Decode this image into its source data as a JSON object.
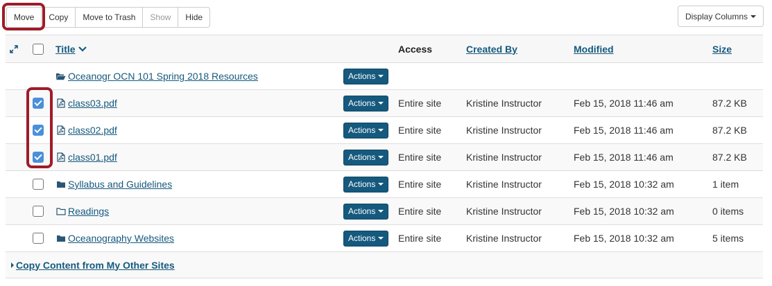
{
  "toolbar": {
    "buttons": [
      {
        "label": "Move",
        "enabled": true
      },
      {
        "label": "Copy",
        "enabled": true
      },
      {
        "label": "Move to Trash",
        "enabled": true
      },
      {
        "label": "Show",
        "enabled": false
      },
      {
        "label": "Hide",
        "enabled": true
      }
    ],
    "display_columns_label": "Display Columns"
  },
  "table": {
    "headers": {
      "title": "Title",
      "access": "Access",
      "created_by": "Created By",
      "modified": "Modified",
      "size": "Size"
    },
    "parent_folder": {
      "title": "Oceanogr OCN 101 Spring 2018 Resources",
      "icon": "folder-open-icon",
      "actions_label": "Actions"
    },
    "rows": [
      {
        "title": "class03.pdf",
        "icon": "file-pdf-icon",
        "checked": true,
        "actions_label": "Actions",
        "access": "Entire site",
        "created_by": "Kristine Instructor",
        "modified": "Feb 15, 2018 11:46 am",
        "size": "87.2 KB"
      },
      {
        "title": "class02.pdf",
        "icon": "file-pdf-icon",
        "checked": true,
        "actions_label": "Actions",
        "access": "Entire site",
        "created_by": "Kristine Instructor",
        "modified": "Feb 15, 2018 11:46 am",
        "size": "87.2 KB"
      },
      {
        "title": "class01.pdf",
        "icon": "file-pdf-icon",
        "checked": true,
        "actions_label": "Actions",
        "access": "Entire site",
        "created_by": "Kristine Instructor",
        "modified": "Feb 15, 2018 11:46 am",
        "size": "87.2 KB"
      },
      {
        "title": "Syllabus and Guidelines",
        "icon": "folder-icon",
        "checked": false,
        "actions_label": "Actions",
        "access": "Entire site",
        "created_by": "Kristine Instructor",
        "modified": "Feb 15, 2018 10:32 am",
        "size": "1 item"
      },
      {
        "title": "Readings",
        "icon": "folder-outline-icon",
        "checked": false,
        "actions_label": "Actions",
        "access": "Entire site",
        "created_by": "Kristine Instructor",
        "modified": "Feb 15, 2018 10:32 am",
        "size": "0 items"
      },
      {
        "title": "Oceanography Websites",
        "icon": "folder-icon",
        "checked": false,
        "actions_label": "Actions",
        "access": "Entire site",
        "created_by": "Kristine Instructor",
        "modified": "Feb 15, 2018 10:32 am",
        "size": "5 items"
      }
    ]
  },
  "footer": {
    "copy_content_label": "Copy Content from My Other Sites"
  },
  "colors": {
    "link": "#15597e",
    "highlight": "#9e1c28",
    "checkbox_checked": "#4a90d9"
  }
}
